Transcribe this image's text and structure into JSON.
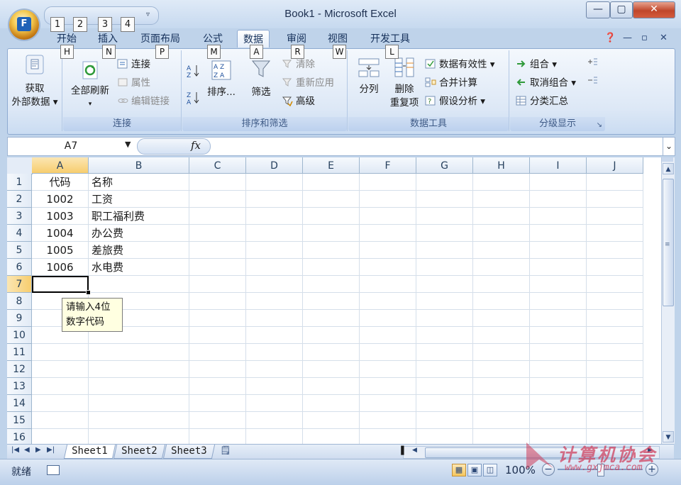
{
  "window": {
    "title": "Book1 - Microsoft Excel",
    "office_button_label": "F",
    "qat_keytips": [
      "1",
      "2",
      "3",
      "4"
    ],
    "minimize": "—",
    "maximize": "▢",
    "close": "✕"
  },
  "tabs": [
    {
      "label": "开始",
      "keytip": "H"
    },
    {
      "label": "插入",
      "keytip": "N"
    },
    {
      "label": "页面布局",
      "keytip": "P"
    },
    {
      "label": "公式",
      "keytip": "M"
    },
    {
      "label": "数据",
      "keytip": "A",
      "active": true
    },
    {
      "label": "审阅",
      "keytip": "R"
    },
    {
      "label": "视图",
      "keytip": "W"
    },
    {
      "label": "开发工具",
      "keytip": "L"
    }
  ],
  "ribbon": {
    "get_external": {
      "line1": "获取",
      "line2": "外部数据"
    },
    "connections_group": {
      "label": "连接",
      "refresh_all": "全部刷新",
      "connections": "连接",
      "properties": "属性",
      "edit_links": "编辑链接"
    },
    "sort_filter_group": {
      "label": "排序和筛选",
      "sort": "排序...",
      "filter": "筛选",
      "clear": "清除",
      "reapply": "重新应用",
      "advanced": "高级"
    },
    "data_tools_group": {
      "label": "数据工具",
      "text_to_columns": "分列",
      "remove_dup_line1": "删除",
      "remove_dup_line2": "重复项",
      "validation": "数据有效性",
      "consolidate": "合并计算",
      "what_if": "假设分析"
    },
    "outline_group": {
      "label": "分级显示",
      "group": "组合",
      "ungroup": "取消组合",
      "subtotal": "分类汇总"
    }
  },
  "formula_bar": {
    "name_box": "A7",
    "fx": "fx",
    "formula": ""
  },
  "grid": {
    "columns": [
      "A",
      "B",
      "C",
      "D",
      "E",
      "F",
      "G",
      "H",
      "I",
      "J"
    ],
    "rows": [
      "1",
      "2",
      "3",
      "4",
      "5",
      "6",
      "7",
      "8",
      "9",
      "10",
      "11",
      "12",
      "13",
      "14",
      "15",
      "16"
    ],
    "cells": [
      [
        "代码",
        "名称"
      ],
      [
        "1002",
        "工资"
      ],
      [
        "1003",
        "职工福利费"
      ],
      [
        "1004",
        "办公费"
      ],
      [
        "1005",
        "差旅费"
      ],
      [
        "1006",
        "水电费"
      ]
    ],
    "active_cell": "A7",
    "input_message": {
      "line1": "请输入4位",
      "line2": "数字代码"
    }
  },
  "sheets": [
    "Sheet1",
    "Sheet2",
    "Sheet3"
  ],
  "active_sheet": "Sheet1",
  "status": {
    "ready": "就绪",
    "zoom": "100%"
  },
  "watermark": {
    "text": "计算机协会",
    "url": "www.gxjmca.com"
  }
}
